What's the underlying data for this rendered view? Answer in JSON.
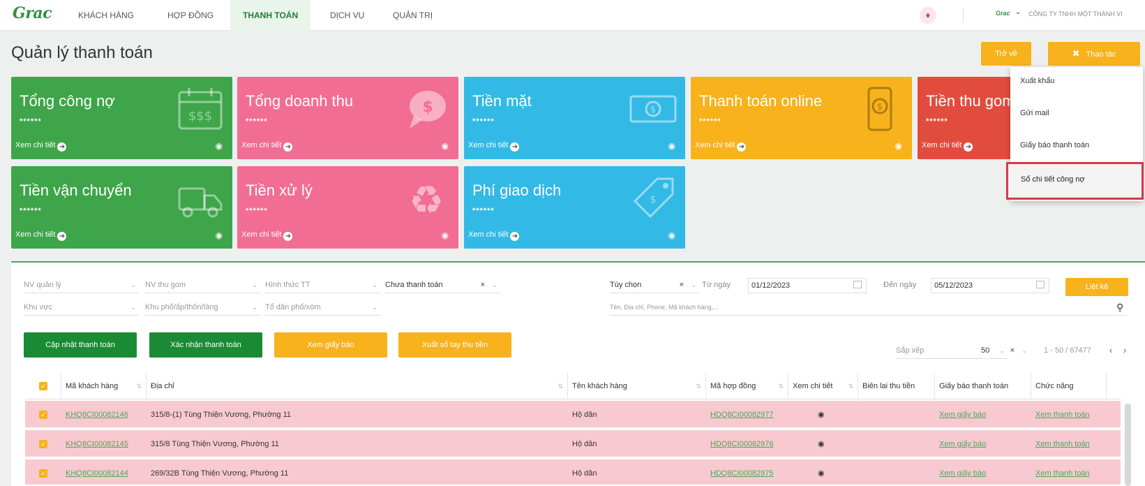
{
  "nav": {
    "logo": "Grac",
    "items": [
      "KHÁCH HÀNG",
      "HỢP ĐỒNG",
      "THANH TOÁN",
      "DỊCH VỤ",
      "QUẢN TRỊ"
    ],
    "active": "THANH TOÁN",
    "company_logo": "Grac",
    "company_name": "CÔNG TY TNHH MỘT THÀNH VI"
  },
  "page": {
    "title": "Quản lý thanh toán",
    "back_label": "Trở về",
    "action_label": "Thao tác"
  },
  "cards": [
    {
      "title": "Tổng công nợ",
      "value": "******",
      "link": "Xem chi tiết",
      "color": "#3ea54a",
      "icon": "calendar-money-icon"
    },
    {
      "title": "Tổng doanh thu",
      "value": "******",
      "link": "Xem chi tiết",
      "color": "#f26d93",
      "icon": "dollar-chat-icon"
    },
    {
      "title": "Tiền mặt",
      "value": "******",
      "link": "Xem chi tiết",
      "color": "#33b9e6",
      "icon": "banknote-icon"
    },
    {
      "title": "Thanh toán online",
      "value": "******",
      "link": "Xem chi tiết",
      "color": "#f7b21c",
      "icon": "phone-payment-icon"
    },
    {
      "title": "Tiền thu gom",
      "value": "******",
      "link": "Xem chi tiết",
      "color": "#e24c3f",
      "icon": "collection-icon"
    },
    {
      "title": "Tiền vận chuyển",
      "value": "******",
      "link": "Xem chi tiết",
      "color": "#3ea54a",
      "icon": "garbage-truck-icon"
    },
    {
      "title": "Tiền xử lý",
      "value": "******",
      "link": "Xem chi tiết",
      "color": "#f26d93",
      "icon": "recycle-icon"
    },
    {
      "title": "Phí giao dịch",
      "value": "******",
      "link": "Xem chi tiết",
      "color": "#33b9e6",
      "icon": "price-tag-icon"
    }
  ],
  "menu": {
    "items": [
      "Xuất khẩu",
      "Gửi mail",
      "Giấy báo thanh toán",
      "Sổ chi tiết công nợ"
    ],
    "highlighted": "Sổ chi tiết công nợ"
  },
  "filters": {
    "nv_quan_ly": "NV quản lý",
    "nv_thu_gom": "NV thu gom",
    "hinh_thuc": "Hình thức TT",
    "trang_thai": "Chưa thanh toán",
    "tuy_chon": "Tùy chọn",
    "tu_ngay_label": "Từ ngày",
    "tu_ngay": "01/12/2023",
    "den_ngay_label": "Đến ngày",
    "den_ngay": "05/12/2023",
    "liet_ke": "Liệt kê",
    "khu_vuc": "Khu vực",
    "khu_pho": "Khu phố/ấp/thôn/làng",
    "to_dan_pho": "Tổ dân phố/xóm",
    "search_placeholder": "Tên, Địa chỉ, Phone, Mã khách hàng,..."
  },
  "buttons": {
    "cap_nhat": "Cập nhật thanh toán",
    "xac_nhan": "Xác nhận thanh toán",
    "xem_giay_bao": "Xem giấy báo",
    "xuat_so_tay": "Xuất sổ tay thu tiền"
  },
  "paging": {
    "sort_placeholder": "Sắp xếp",
    "page_size": "50",
    "range": "1 - 50 / 67477"
  },
  "table": {
    "headers": [
      "Mã khách hàng",
      "Địa chỉ",
      "Tên khách hàng",
      "Mã hợp đồng",
      "Xem chi tiết",
      "Biên lai thu tiền",
      "Giấy báo thanh toán",
      "Chức năng"
    ],
    "rows": [
      {
        "ma_kh": "KHQ8CI00082146",
        "dia_chi": "315/8-(1) Tùng Thiện Vương, Phường 11",
        "ten": "Hộ dân",
        "ma_hd": "HDQ8CI00082977",
        "giay_bao": "Xem giấy báo",
        "chuc_nang": "Xem thanh toán"
      },
      {
        "ma_kh": "KHQ8CI00082145",
        "dia_chi": "315/8 Tùng Thiện Vương, Phường 11",
        "ten": "Hộ dân",
        "ma_hd": "HDQ8CI00082976",
        "giay_bao": "Xem giấy báo",
        "chuc_nang": "Xem thanh toán"
      },
      {
        "ma_kh": "KHQ8CI00082144",
        "dia_chi": "269/32B Tùng Thiện Vương, Phường 11",
        "ten": "Hộ dân",
        "ma_hd": "HDQ8CI00082975",
        "giay_bao": "Xem giấy báo",
        "chuc_nang": "Xem thanh toán"
      }
    ]
  }
}
